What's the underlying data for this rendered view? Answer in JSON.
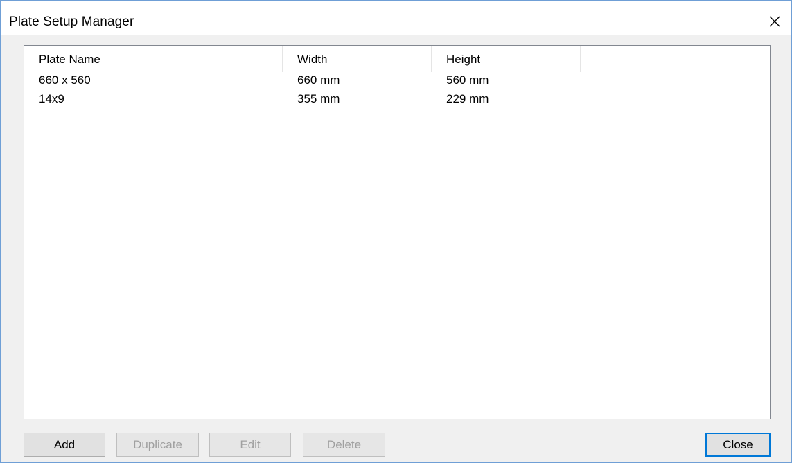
{
  "window": {
    "title": "Plate Setup Manager"
  },
  "list": {
    "columns": [
      "Plate Name",
      "Width",
      "Height"
    ],
    "rows": [
      {
        "name": "660 x 560",
        "width": "660 mm",
        "height": "560 mm"
      },
      {
        "name": "14x9",
        "width": "355 mm",
        "height": "229 mm"
      }
    ]
  },
  "buttons": {
    "add": "Add",
    "duplicate": "Duplicate",
    "edit": "Edit",
    "delete": "Delete",
    "close": "Close"
  },
  "icons": {
    "close": "close-icon"
  },
  "colors": {
    "window_border": "#6f9fd6",
    "dialog_background": "#f0f0f0",
    "default_button_border": "#0078d7",
    "disabled_text": "#a0a0a0"
  }
}
